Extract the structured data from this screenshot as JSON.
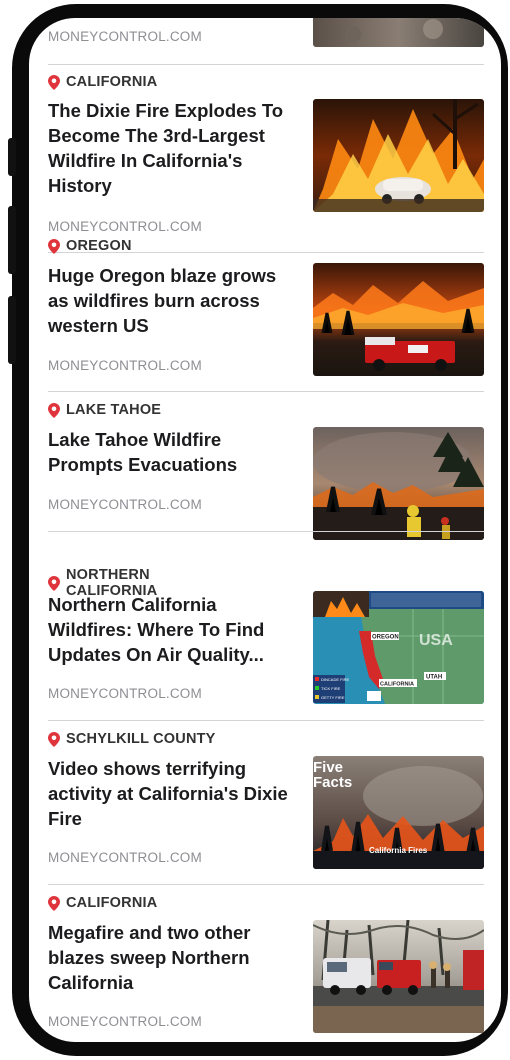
{
  "feed": {
    "top_source": "MONEYCONTROL.COM",
    "items": [
      {
        "location": "CALIFORNIA",
        "title": "The Dixie Fire Explodes To Become The 3rd-Largest Wildfire In California's History",
        "source": "MONEYCONTROL.COM",
        "thumb": "house-fire-car"
      },
      {
        "location": "OREGON",
        "title": "Huge Oregon blaze grows as wildfires burn across western US",
        "source": "MONEYCONTROL.COM",
        "thumb": "fire-truck-blaze"
      },
      {
        "location": "LAKE TAHOE",
        "title": "Lake Tahoe Wildfire Prompts Evacuations",
        "source": "MONEYCONTROL.COM",
        "thumb": "firefighter-smoke"
      },
      {
        "location": "NORTHERN CALIFORNIA",
        "title": "Northern California Wildfires: Where To Find Updates On Air Quality...",
        "source": "MONEYCONTROL.COM",
        "thumb": "wildfire-map",
        "map_labels": {
          "region": "USA",
          "oregon": "OREGON",
          "california": "CALIFORNIA",
          "utah": "UTAH",
          "legend": [
            "DINCADE FIRE",
            "TICK FIRE",
            "GETTY FIRE"
          ]
        }
      },
      {
        "location": "SCHYLKILL COUNTY",
        "title": "Video shows terrifying activity at California's Dixie Fire",
        "source": "MONEYCONTROL.COM",
        "thumb": "five-facts",
        "thumb_text": {
          "heading_1": "Five",
          "heading_2": "Facts",
          "caption": "California Fires"
        }
      },
      {
        "location": "CALIFORNIA",
        "title": "Megafire and two other blazes sweep Northern California",
        "source": "MONEYCONTROL.COM",
        "thumb": "fire-trucks-road"
      }
    ]
  },
  "colors": {
    "pin": "#e0343c",
    "location_text": "#333333",
    "title_text": "#1c1c1e",
    "source_text": "#8e8e93",
    "divider": "#d4d4d8"
  }
}
